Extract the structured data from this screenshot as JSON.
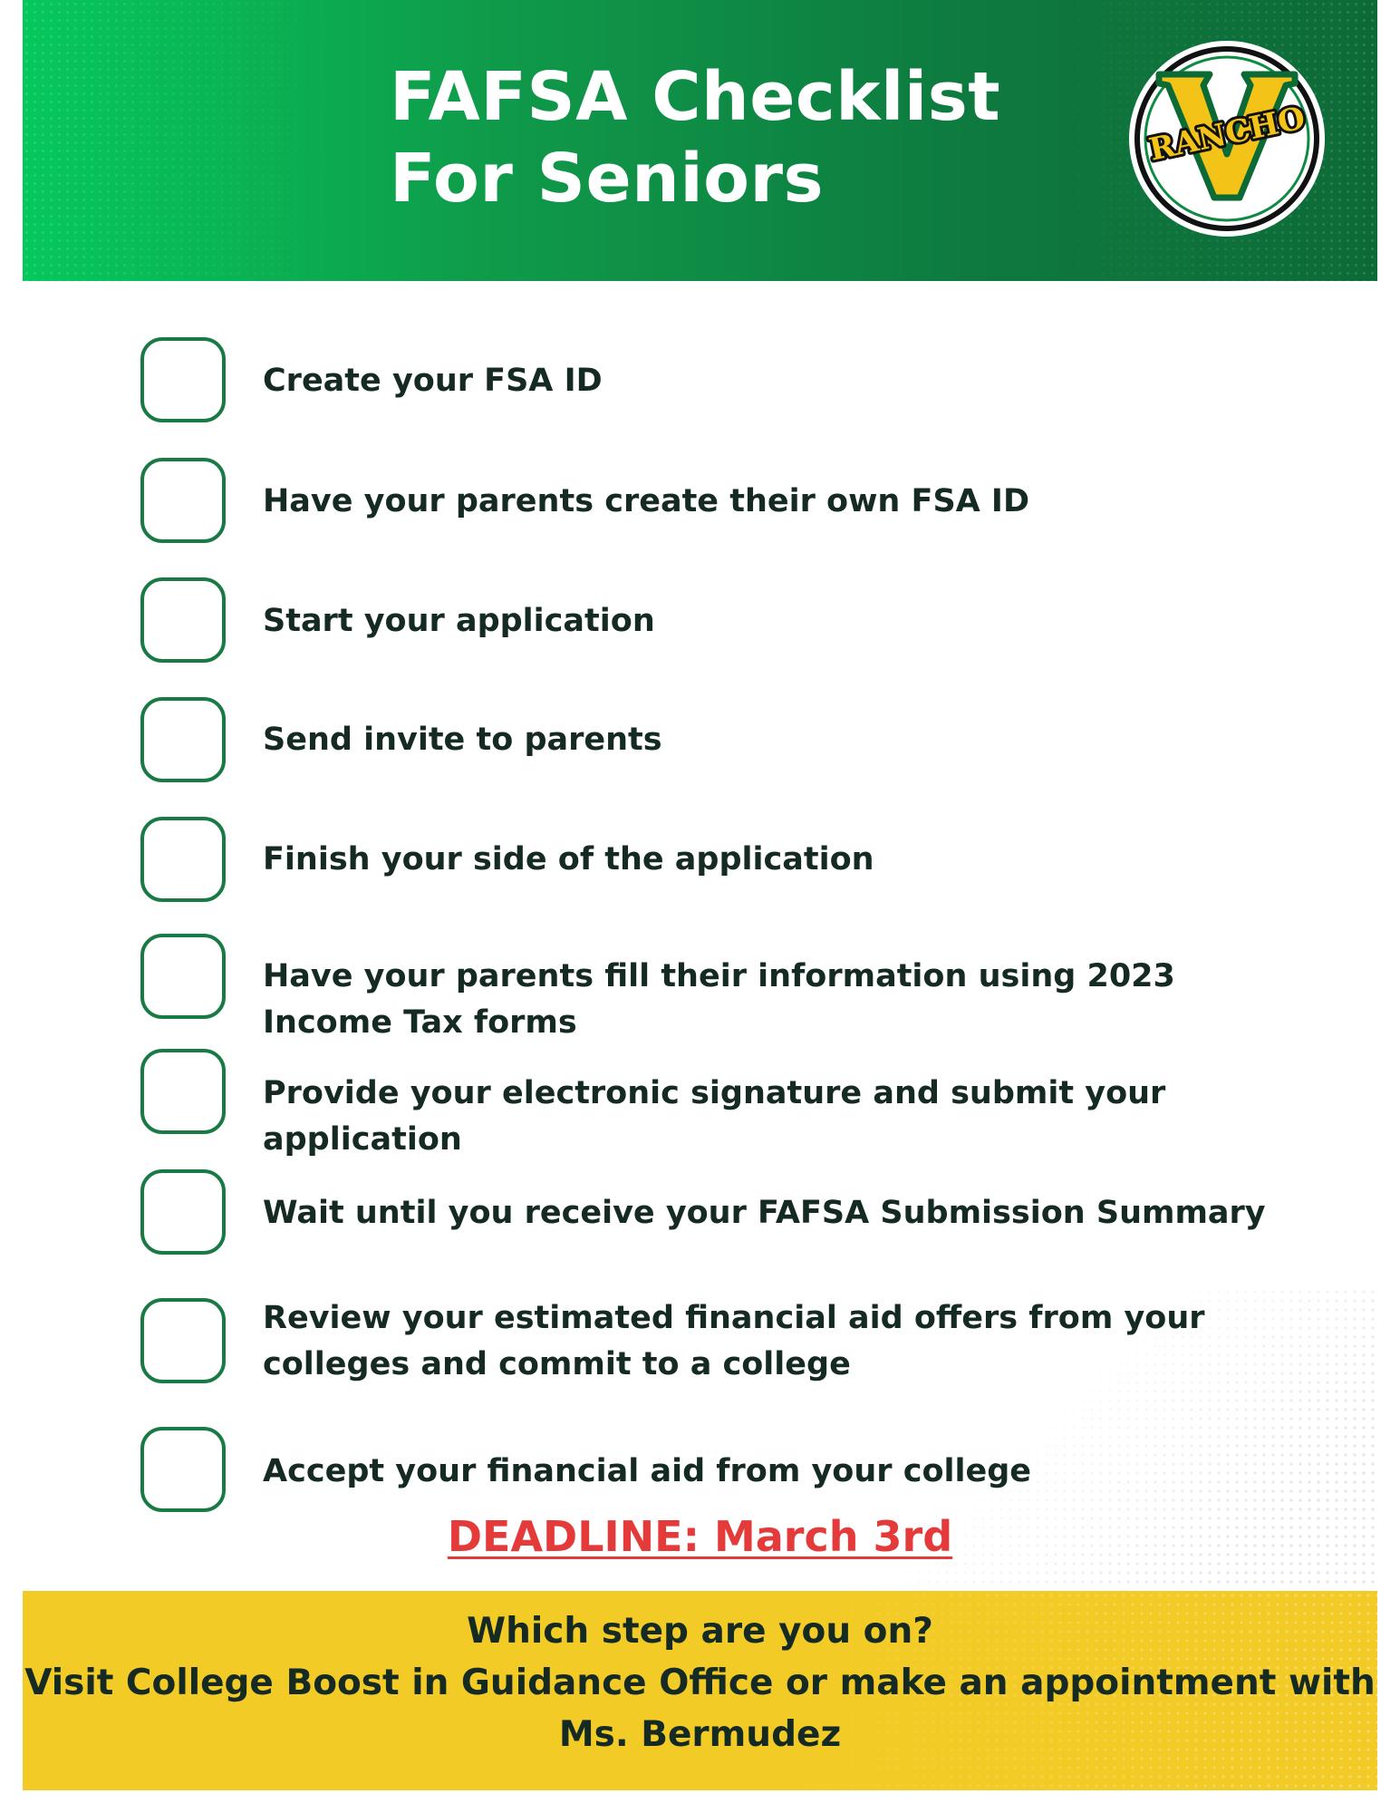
{
  "header": {
    "title_line1": "FAFSA Checklist",
    "title_line2": "For Seniors",
    "logo_text": "RANCHO",
    "logo_letter": "V"
  },
  "checklist": {
    "items": [
      {
        "label": "Create your FSA ID",
        "checked": false
      },
      {
        "label": "Have your parents create their own FSA ID",
        "checked": false
      },
      {
        "label": "Start your application",
        "checked": false
      },
      {
        "label": "Send invite to parents",
        "checked": false
      },
      {
        "label": "Finish your side of the application",
        "checked": false
      },
      {
        "label": "Have your parents fill their information using 2023 Income Tax forms",
        "checked": false
      },
      {
        "label": "Provide your electronic signature and submit your application",
        "checked": false
      },
      {
        "label": "Wait until you receive your FAFSA Submission Summary",
        "checked": false
      },
      {
        "label": "Review your estimated financial aid offers from your colleges and commit to a college",
        "checked": false
      },
      {
        "label": "Accept your financial aid from your college",
        "checked": false
      }
    ]
  },
  "deadline": "DEADLINE: March 3rd",
  "footer": {
    "line1": "Which step are you on?",
    "line2": "Visit College Boost in Guidance Office or make an appointment with",
    "line3": "Ms. Bermudez"
  },
  "colors": {
    "header_green": "#0e7a3f",
    "accent_yellow": "#f3cb27",
    "deadline_red": "#e53a3a",
    "checkbox_green": "#1a7a45"
  }
}
